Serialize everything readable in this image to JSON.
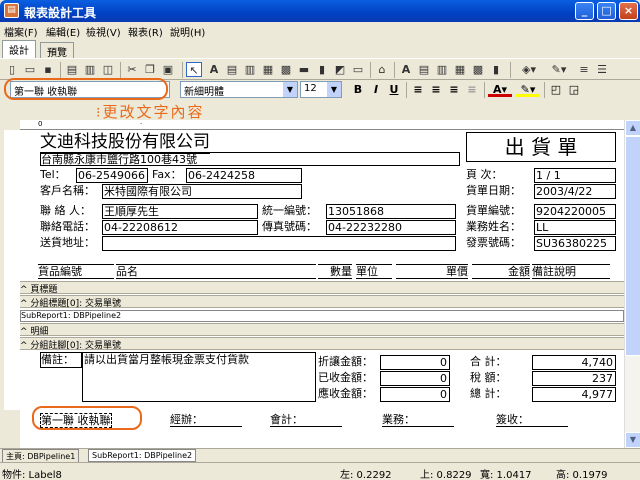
{
  "window": {
    "title": "報表設計工具",
    "icon": "report-icon",
    "minimize": "_",
    "maximize": "□",
    "close": "×"
  },
  "menu": [
    "檔案(F)",
    "編輯(E)",
    "檢視(V)",
    "報表(R)",
    "說明(H)"
  ],
  "tabs": [
    "設計",
    "預覽"
  ],
  "formatbar": {
    "text_value": "第一聯 收執聯",
    "font_name": "新細明體",
    "font_size": "12",
    "bold": "B",
    "italic": "I",
    "underline": "U",
    "underline_color_glyph": "A"
  },
  "annotation": {
    "hint": "更改文字內容",
    "accent": "#e86a1a"
  },
  "report": {
    "company": "文迪科技股份有限公司",
    "doc_title": "出  貨  單",
    "address": "台南縣永康市鹽行路100巷43號",
    "tel_label": "Tel：",
    "tel": "06-2549066",
    "fax_label": "Fax：",
    "fax": "06-2424258",
    "page_label": "頁    次：",
    "page": "1 / 1",
    "customer_label": "客戶名稱：",
    "customer": "米特國際有限公司",
    "date_label": "貨單日期：",
    "date": "2003/4/22",
    "contact_label": "聯 絡 人：",
    "contact": "王順厚先生",
    "taxid_label": "統一編號：",
    "taxid": "13051868",
    "docno_label": "貨單編號：",
    "docno": "9204220005",
    "phone_label": "聯絡電話：",
    "phone": "04-22208612",
    "faxno_label": "傳真號碼：",
    "faxno": "04-22232280",
    "sales_label": "業務姓名：",
    "sales": "LL",
    "ship_label": "送貨地址：",
    "ship": "",
    "invoice_label": "發票號碼：",
    "invoice": "SU36380225",
    "columns": [
      "貨品編號",
      "品名",
      "數量",
      "單位",
      "單價",
      "金額",
      "備註說明"
    ],
    "band_title": "^ 頁標題",
    "band_group_header": "^ 分組標題[0]: 交易單號",
    "subreport": "SubReport1: DBPipeline2",
    "band_detail": "^ 明細",
    "band_group_footer": "^ 分組註腳[0]: 交易單號",
    "note_label": "備註：",
    "note": "請以出貨當月整帳現金票支付貨款",
    "discount_label": "折讓金額：",
    "discount": "0",
    "received_label": "已收金額：",
    "received": "0",
    "due_label": "應收金額：",
    "due": "0",
    "subtotal_label": "合    計：",
    "subtotal": "4,740",
    "tax_label": "稅    額：",
    "tax": "237",
    "total_label": "總    計：",
    "total": "4,977",
    "copy_label": "第一聯 收執聯",
    "handler_label": "經辦：",
    "accounting_label": "會計：",
    "business_label": "業務：",
    "sign_label": "簽收："
  },
  "bottom_tabs": [
    "主頁: DBPipeline1",
    "SubReport1: DBPipeline2"
  ],
  "status": {
    "object": "物件: Label8",
    "left": "左: 0.2292",
    "top": "上: 0.8229",
    "width": "寬: 1.0417",
    "height": "高: 0.1979"
  },
  "colors": {
    "titlebar": "#0a5fe0",
    "company_underline": "#000"
  }
}
